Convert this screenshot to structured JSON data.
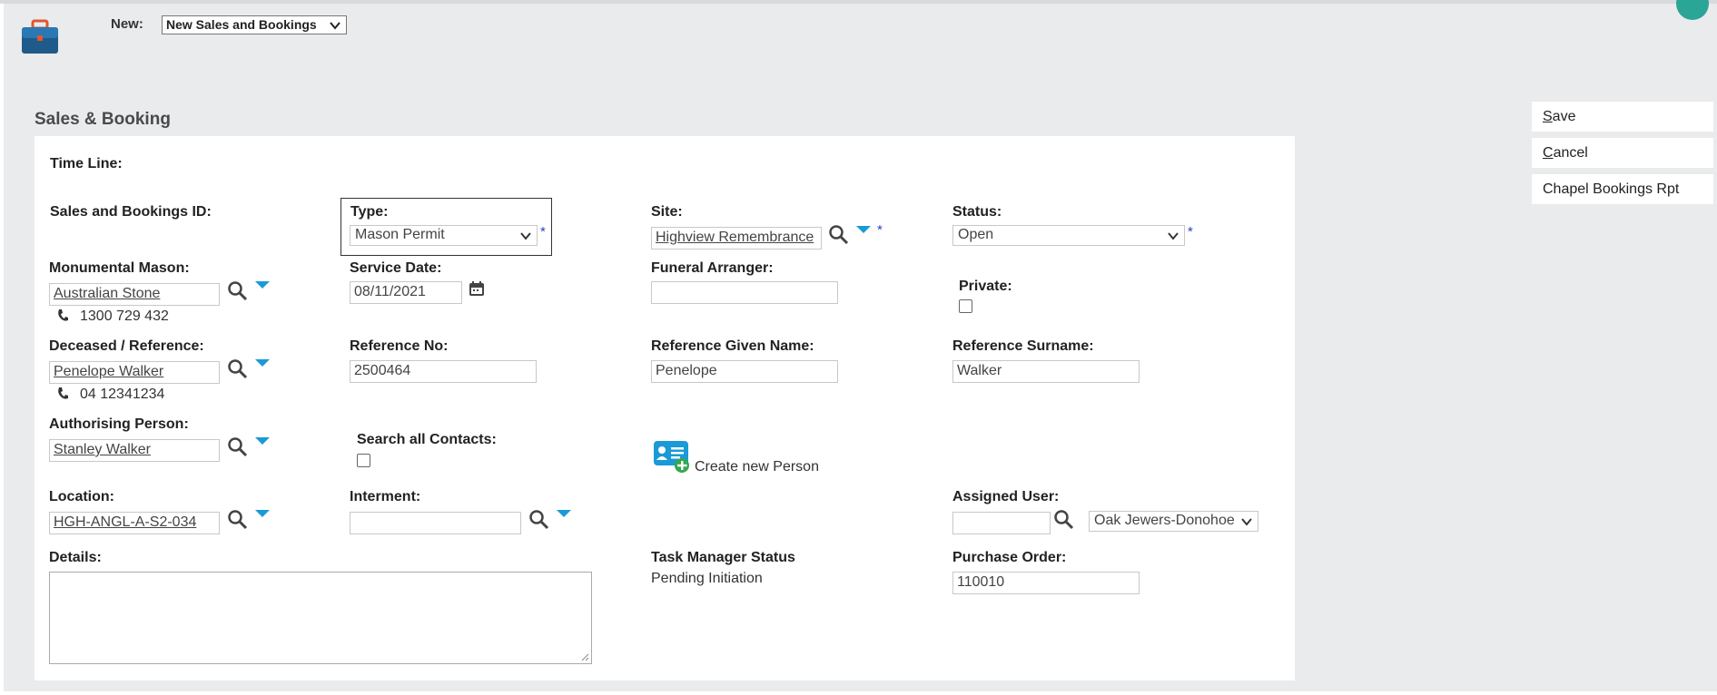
{
  "header": {
    "new_label": "New:",
    "new_select_value": "New Sales and Bookings"
  },
  "section": {
    "title": "Sales & Booking"
  },
  "form": {
    "timeline_label": "Time Line:",
    "id_label": "Sales and Bookings ID:",
    "type_label": "Type:",
    "type_value": "Mason Permit",
    "site_label": "Site:",
    "site_value": "Highview Remembrance",
    "status_label": "Status:",
    "status_value": "Open",
    "required_mark": "*",
    "mason_label": "Monumental Mason:",
    "mason_value": "Australian Stone",
    "mason_phone": "1300 729 432",
    "service_date_label": "Service Date:",
    "service_date_value": "08/11/2021",
    "funeral_arranger_label": "Funeral Arranger:",
    "funeral_arranger_value": "",
    "private_label": "Private:",
    "deceased_label": "Deceased / Reference:",
    "deceased_value": "Penelope Walker",
    "deceased_phone": "04 12341234",
    "reference_no_label": "Reference No:",
    "reference_no_value": "2500464",
    "ref_given_label": "Reference Given Name:",
    "ref_given_value": "Penelope",
    "ref_surname_label": "Reference Surname:",
    "ref_surname_value": "Walker",
    "auth_label": "Authorising Person:",
    "auth_value": "Stanley Walker",
    "search_contacts_label": "Search all Contacts:",
    "create_person_label": "Create new Person",
    "location_label": "Location:",
    "location_value": "HGH-ANGL-A-S2-034",
    "interment_label": "Interment:",
    "interment_value": "",
    "assigned_user_label": "Assigned User:",
    "assigned_user_input": "",
    "assigned_user_select": "Oak Jewers-Donohoe",
    "details_label": "Details:",
    "task_status_label": "Task Manager Status",
    "task_status_value": "Pending Initiation",
    "po_label": "Purchase Order:",
    "po_value": "110010"
  },
  "actions": {
    "save_first": "S",
    "save_rest": "ave",
    "cancel_first": "C",
    "cancel_rest": "ancel",
    "report": "Chapel Bookings Rpt"
  },
  "colors": {
    "accent": "#1a9ad6",
    "background": "#eaebed",
    "teal": "#2aa596"
  }
}
